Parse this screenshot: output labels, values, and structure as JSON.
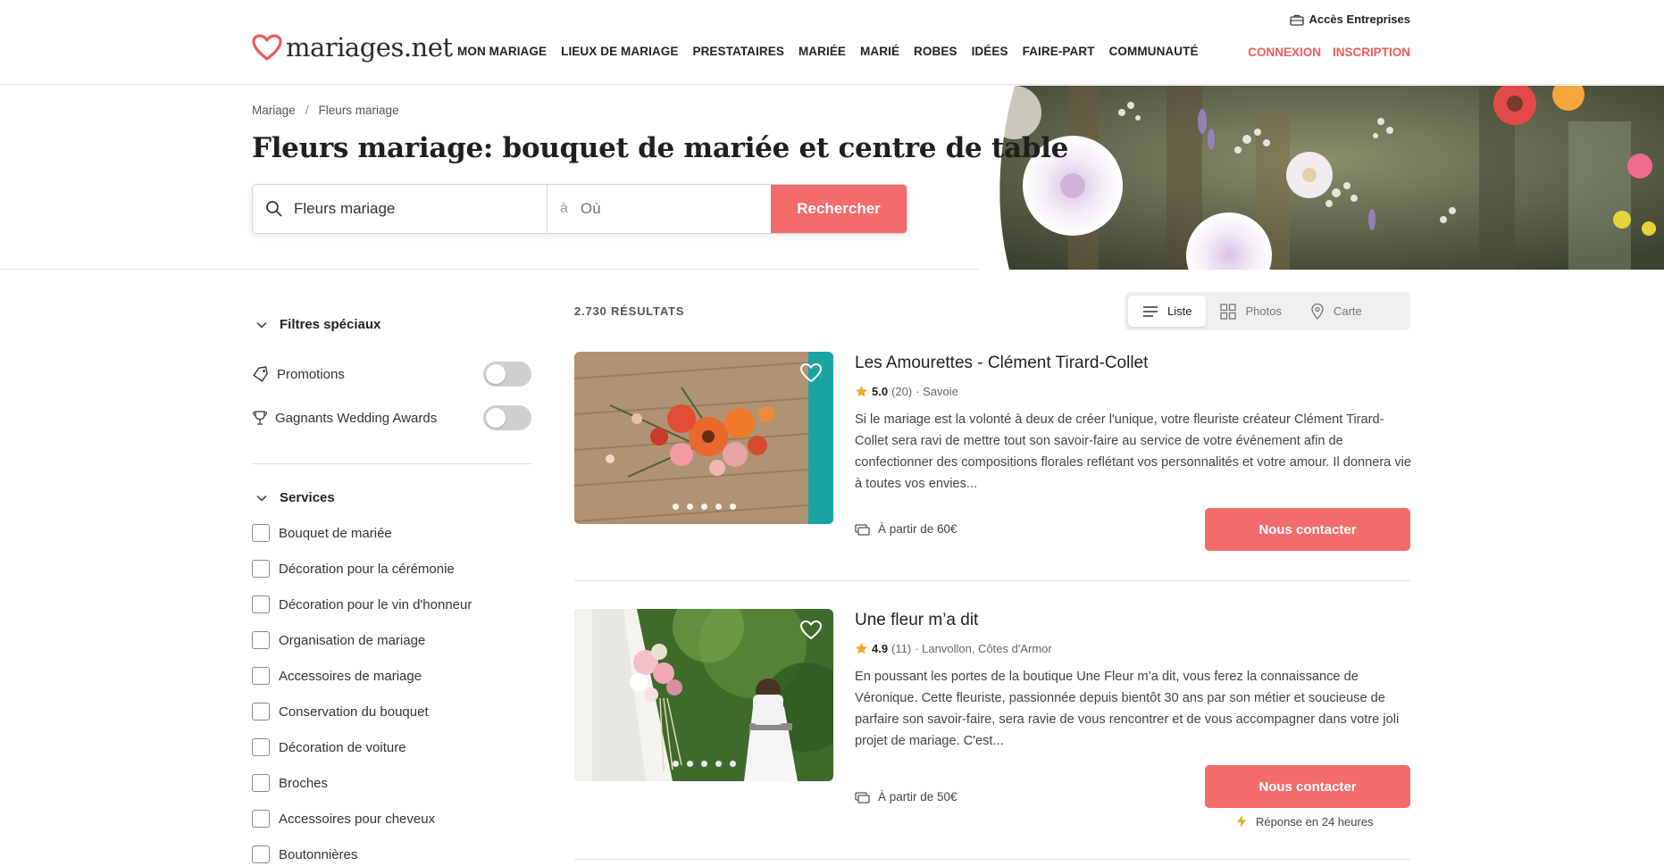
{
  "header": {
    "logo_text": "mariages.net",
    "nav": [
      "MON MARIAGE",
      "LIEUX DE MARIAGE",
      "PRESTATAIRES",
      "MARIÉE",
      "MARIÉ",
      "ROBES",
      "IDÉES",
      "FAIRE-PART",
      "COMMUNAUTÉ"
    ],
    "acces": "Accès Entreprises",
    "login": "CONNEXION",
    "signup": "INSCRIPTION"
  },
  "hero": {
    "breadcrumb": [
      "Mariage",
      "Fleurs mariage"
    ],
    "title": "Fleurs mariage: bouquet de mariée et centre de table",
    "search_what": "Fleurs mariage",
    "search_where_prefix": "à",
    "search_where_placeholder": "Où",
    "search_button": "Rechercher"
  },
  "sidebar": {
    "special_title": "Filtres spéciaux",
    "toggles": [
      {
        "label": "Promotions",
        "icon": "tag-icon",
        "on": false
      },
      {
        "label": "Gagnants Wedding Awards",
        "icon": "trophy-icon",
        "on": false
      }
    ],
    "services_title": "Services",
    "services": [
      "Bouquet de mariée",
      "Décoration pour la cérémonie",
      "Décoration pour le vin d'honneur",
      "Organisation de mariage",
      "Accessoires de mariage",
      "Conservation du bouquet",
      "Décoration de voiture",
      "Broches",
      "Accessoires pour cheveux",
      "Boutonnières"
    ]
  },
  "results": {
    "count": "2.730 RÉSULTATS",
    "views": [
      "Liste",
      "Photos",
      "Carte"
    ],
    "active_view": "Liste",
    "cards": [
      {
        "title": "Les Amourettes - Clément Tirard-Collet",
        "rating": "5.0",
        "reviews": "(20)",
        "location": "· Savoie",
        "description": "Si le mariage est la volonté à deux de créer l'unique, votre fleuriste créateur Clément Tirard-Collet sera ravi de mettre tout son savoir-faire au service de votre événement afin de confectionner des compositions florales reflétant vos personnalités et votre amour. Il donnera vie à toutes vos envies...",
        "price": "À partir de 60€",
        "button": "Nous contacter"
      },
      {
        "title": "Une fleur m’a dit",
        "rating": "4.9",
        "reviews": "(11)",
        "location": "· Lanvollon, Côtes d'Armor",
        "description": "En poussant les portes de la boutique Une Fleur m’a dit, vous ferez la connaissance de Véronique. Cette fleuriste, passionnée depuis bientôt 30 ans par son métier et soucieuse de parfaire son savoir-faire, sera ravie de vous rencontrer et de vous accompagner dans votre joli projet de mariage. C'est...",
        "price": "À partir de 50€",
        "button": "Nous contacter",
        "fast_reply": "Réponse en 24 heures"
      }
    ]
  },
  "colors": {
    "accent": "#f26c6c",
    "star": "#f5a623"
  }
}
